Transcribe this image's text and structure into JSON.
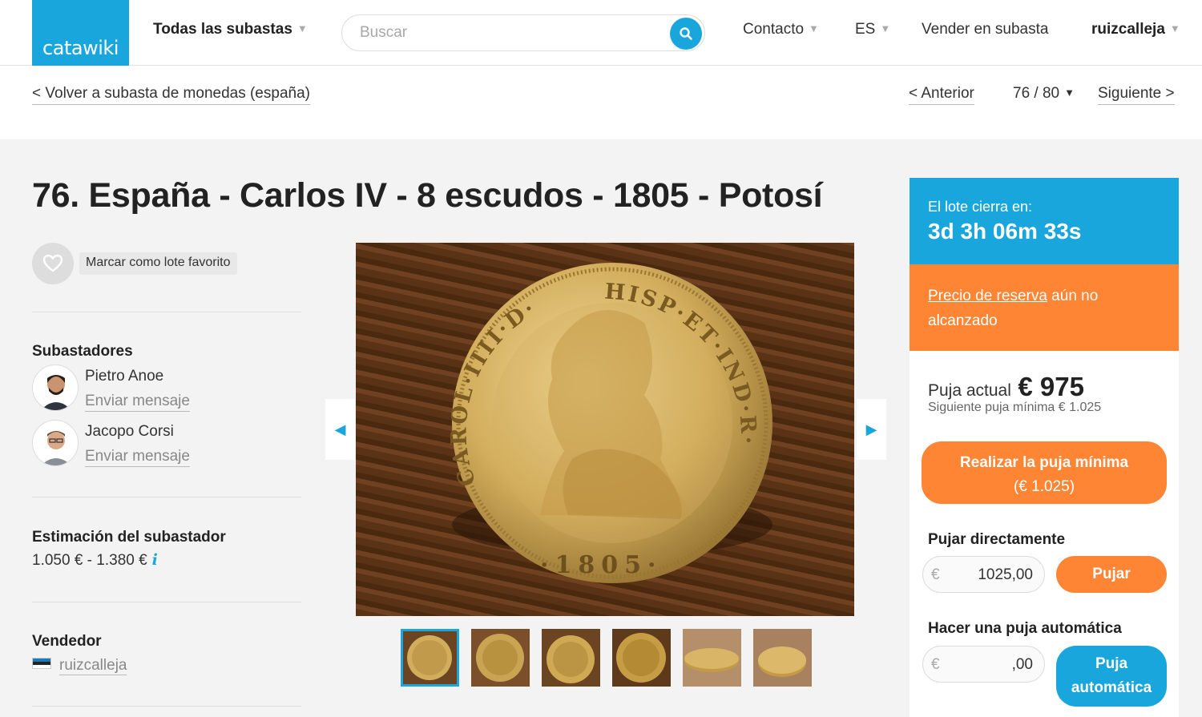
{
  "header": {
    "logo": "catawiki",
    "all_auctions": "Todas las subastas",
    "search_placeholder": "Buscar",
    "contact": "Contacto",
    "language": "ES",
    "sell": "Vender en subasta",
    "username": "ruizcalleja"
  },
  "subnav": {
    "back": "< Volver a subasta de monedas (españa)",
    "previous": "< Anterior",
    "position": "76 / 80",
    "next": "Siguiente >"
  },
  "lot": {
    "title": "76. España - Carlos IV - 8 escudos - 1805 - Potosí",
    "favorite": "Marcar como lote favorito"
  },
  "auctioneers": {
    "heading": "Subastadores",
    "people": [
      {
        "name": "Pietro Anoe",
        "action": "Enviar mensaje"
      },
      {
        "name": "Jacopo Corsi",
        "action": "Enviar mensaje"
      }
    ]
  },
  "estimate": {
    "heading": "Estimación del subastador",
    "value": "1.050 € - 1.380 €",
    "info_icon": "i"
  },
  "seller": {
    "heading": "Vendedor",
    "name": "ruizcalleja"
  },
  "coin": {
    "legend_left": "CAROL·IIII·D·G·",
    "legend_right": "HISP·ET·IND·R·",
    "year": "·1805·"
  },
  "bid_panel": {
    "closes_label": "El lote cierra en:",
    "countdown": "3d 3h 06m 33s",
    "reserve_link": "Precio de reserva",
    "reserve_rest": " aún no alcanzado",
    "current_label": "Puja actual",
    "current_value": "€ 975",
    "next_min": "Siguiente puja mínima € 1.025",
    "min_bid_line1": "Realizar la puja mínima",
    "min_bid_line2": "(€ 1.025)",
    "direct_heading": "Pujar directamente",
    "currency": "€",
    "direct_value": "1025,00",
    "direct_button": "Pujar",
    "auto_heading": "Hacer una puja automática",
    "auto_value": ",00",
    "auto_button_line1": "Puja",
    "auto_button_line2": "automática"
  },
  "colors": {
    "brand_blue": "#19a6dd",
    "accent_orange": "#fe8533"
  }
}
